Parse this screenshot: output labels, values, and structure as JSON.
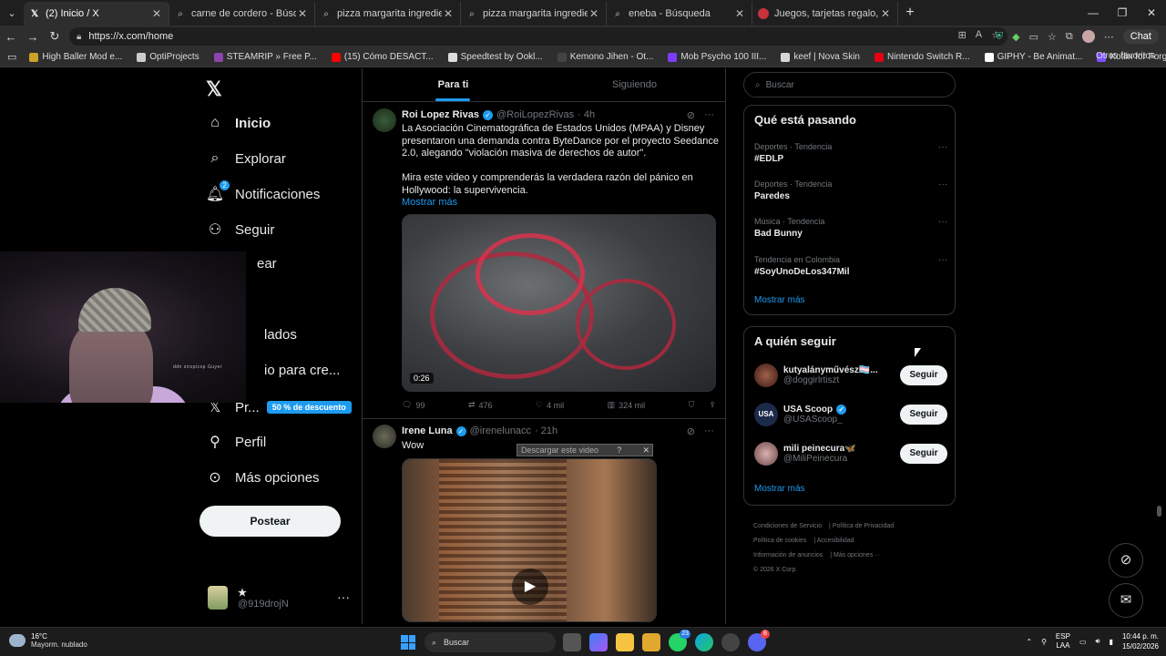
{
  "browser": {
    "tabs": [
      {
        "label": "(2) Inicio / X",
        "icon": "x-logo-icon",
        "active": true
      },
      {
        "label": "carne de cordero - Búsqueda Imá",
        "icon": "search-icon"
      },
      {
        "label": "pizza margarita ingredientes - Bús",
        "icon": "search-icon"
      },
      {
        "label": "pizza margarita ingredientes - Bús",
        "icon": "search-icon"
      },
      {
        "label": "eneba - Búsqueda",
        "icon": "search-icon"
      },
      {
        "label": "Juegos, tarjetas regalo, recargas y",
        "icon": "eneba-icon"
      }
    ],
    "url": "https://x.com/home",
    "chat_label": "Chat",
    "bookmarks": [
      {
        "label": "High Baller Mod e...",
        "color": "#c9a227"
      },
      {
        "label": "OptiProjects",
        "color": "#cccccc"
      },
      {
        "label": "STEAMRIP » Free P...",
        "color": "#8e44ad"
      },
      {
        "label": "(15) Cómo DESACT...",
        "color": "#ff0000"
      },
      {
        "label": "Speedtest by Ookl...",
        "color": "#dddddd"
      },
      {
        "label": "Kemono Jihen - Ot...",
        "color": "#444444"
      },
      {
        "label": "Mob Psycho 100 III...",
        "color": "#7d3cff"
      },
      {
        "label": "keef | Nova Skin",
        "color": "#d6d6d6"
      },
      {
        "label": "Nintendo Switch R...",
        "color": "#e60012"
      },
      {
        "label": "GIPHY - Be Animat...",
        "color": "#ffffff"
      },
      {
        "label": "Kotlin for Forge M...",
        "color": "#7f52ff"
      }
    ],
    "other_bookmarks": "Otros favoritos"
  },
  "nav": {
    "items": [
      {
        "label": "Inicio",
        "icon": "home-icon"
      },
      {
        "label": "Explorar",
        "icon": "search-icon"
      },
      {
        "label": "Notificaciones",
        "icon": "bell-icon",
        "badge": "2"
      },
      {
        "label": "Seguir",
        "icon": "person-add-icon"
      },
      {
        "label": "ear",
        "icon": "hidden-icon"
      },
      {
        "label": "lados",
        "icon": "hidden-icon"
      },
      {
        "label": "io para cre...",
        "icon": "hidden-icon"
      },
      {
        "label": "Pr...",
        "icon": "x-logo-icon",
        "promo": "50 % de descuento"
      },
      {
        "label": "Perfil",
        "icon": "person-icon"
      },
      {
        "label": "Más opciones",
        "icon": "more-circle-icon"
      }
    ],
    "post_button": "Postear",
    "account": {
      "name": "★",
      "handle": "@919drojN"
    }
  },
  "webcam_text": "ddn siropicsp Guyer",
  "timeline": {
    "tabs": [
      "Para ti",
      "Siguiendo"
    ],
    "tweets": [
      {
        "name": "Roi Lopez Rivas",
        "handle": "@RoiLopezRivas",
        "time": "· 4h",
        "text1": "La Asociación Cinematográfica de Estados Unidos (MPAA) y Disney presentaron una demanda contra ByteDance por el proyecto Seedance 2.0, alegando \"violación masiva de derechos de autor\".",
        "text2": "Mira este video y comprenderás la verdadera razón del pánico en Hollywood: la supervivencia.",
        "more": "Mostrar más",
        "video_time": "0:26",
        "stats": {
          "replies": "99",
          "reposts": "476",
          "likes": "4 mil",
          "views": "324 mil"
        }
      },
      {
        "name": "Irene Luna",
        "handle": "@irenelunacc",
        "time": "· 21h",
        "text1": "Wow",
        "download_bar": "Descargar este video"
      }
    ]
  },
  "right": {
    "search_placeholder": "Buscar",
    "trends_title": "Qué está pasando",
    "trends": [
      {
        "meta": "Deportes · Tendencia",
        "name": "#EDLP"
      },
      {
        "meta": "Deportes · Tendencia",
        "name": "Paredes"
      },
      {
        "meta": "Música · Tendencia",
        "name": "Bad Bunny"
      },
      {
        "meta": "Tendencia en Colombia",
        "name": "#SoyUnoDeLos347Mil"
      }
    ],
    "trends_more": "Mostrar más",
    "follow_title": "A quién seguir",
    "follow": [
      {
        "name": "kutyalányművész🏳️‍⚧️...",
        "handle": "@doggirlrtiszt",
        "button": "Seguir",
        "color": "#7a4a3a"
      },
      {
        "name": "USA Scoop",
        "handle": "@USAScoop_",
        "button": "Seguir",
        "color": "#1c2a4a"
      },
      {
        "name": "mili peinecura🦋",
        "handle": "@MiliPeinecura",
        "button": "Seguir",
        "color": "#b88a8a"
      }
    ],
    "follow_more": "Mostrar más",
    "footer": [
      "Condiciones de Servicio",
      "Política de Privacidad",
      "Política de cookies",
      "Accesibilidad",
      "Información de anuncios",
      "Más opciones ···",
      "© 2026 X Corp."
    ]
  },
  "taskbar": {
    "temp": "16°C",
    "weather": "Mayorm. nublado",
    "search": "Buscar",
    "chat_count": "23",
    "discord_count": "8",
    "lang": "ESP",
    "lang2": "LAA",
    "time": "10:44 p. m.",
    "date": "15/02/2026"
  }
}
